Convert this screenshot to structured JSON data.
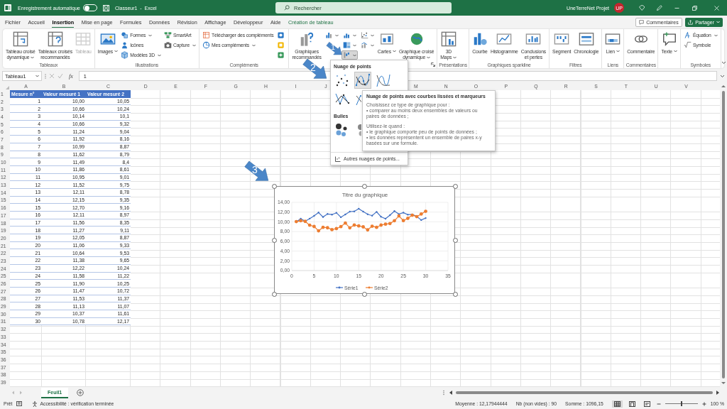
{
  "title_bar": {
    "autosave": {
      "label": "Enregistrement automatique",
      "on": false
    },
    "title": "Classeur1  -  Excel",
    "search": {
      "placeholder": "Rechercher"
    },
    "user": "UneTerreNet Projet",
    "avatar": "UP"
  },
  "menu": {
    "tabs": [
      {
        "label": "Fichier",
        "selected": false,
        "kind": "normal"
      },
      {
        "label": "Accueil",
        "selected": false,
        "kind": "normal"
      },
      {
        "label": "Insertion",
        "selected": true,
        "kind": "normal"
      },
      {
        "label": "Mise en page",
        "selected": false,
        "kind": "normal"
      },
      {
        "label": "Formules",
        "selected": false,
        "kind": "normal"
      },
      {
        "label": "Données",
        "selected": false,
        "kind": "normal"
      },
      {
        "label": "Révision",
        "selected": false,
        "kind": "normal"
      },
      {
        "label": "Affichage",
        "selected": false,
        "kind": "normal"
      },
      {
        "label": "Développeur",
        "selected": false,
        "kind": "normal"
      },
      {
        "label": "Aide",
        "selected": false,
        "kind": "normal"
      },
      {
        "label": "Création de tableau",
        "selected": false,
        "kind": "contextual"
      }
    ],
    "buttons": [
      {
        "label": "Commentaires",
        "kind": "outline"
      },
      {
        "label": "Partager",
        "kind": "primary"
      }
    ]
  },
  "ribbon": {
    "groups": [
      {
        "label": "Tableaux",
        "launcher": false,
        "items": [
          {
            "kind": "large",
            "lines": [
              "Tableau croisé",
              "dynamique"
            ],
            "dropdown": true,
            "disabled": false
          },
          {
            "kind": "large",
            "lines": [
              "Tableaux croisés",
              "recommandés"
            ],
            "dropdown": false,
            "disabled": false
          },
          {
            "kind": "large",
            "lines": [
              "Tableau"
            ],
            "dropdown": false,
            "disabled": true
          }
        ]
      },
      {
        "label": "Illustrations",
        "launcher": false,
        "items": [
          {
            "kind": "large",
            "lines": [
              "Images"
            ],
            "dropdown": true,
            "disabled": false
          },
          {
            "kind": "stack",
            "items": [
              {
                "kind": "small",
                "label": "Formes",
                "dropdown": true
              },
              {
                "kind": "small",
                "label": "Icônes",
                "dropdown": false
              },
              {
                "kind": "small",
                "label": "Modèles 3D",
                "dropdown": true
              }
            ]
          },
          {
            "kind": "stack",
            "items": [
              {
                "kind": "small",
                "label": "SmartArt",
                "dropdown": false
              },
              {
                "kind": "small",
                "label": "Capture",
                "dropdown": true
              }
            ]
          }
        ]
      },
      {
        "label": "Compléments",
        "launcher": false,
        "items": [
          {
            "kind": "stack",
            "items": [
              {
                "kind": "small",
                "label": "Télécharger des compléments",
                "dropdown": false
              },
              {
                "kind": "small",
                "label": "Mes compléments",
                "dropdown": true
              }
            ]
          },
          {
            "kind": "stack",
            "items": [
              {
                "kind": "icon",
                "dropdown": false,
                "expanded": false
              },
              {
                "kind": "icon",
                "dropdown": false,
                "expanded": false
              },
              {
                "kind": "icon",
                "dropdown": false,
                "expanded": false
              }
            ]
          }
        ]
      },
      {
        "launcher": true,
        "items": [
          {
            "kind": "large",
            "lines": [
              "Graphiques",
              "recommandés"
            ],
            "dropdown": false,
            "disabled": false
          },
          {
            "kind": "stack",
            "items": [
              {
                "kind": "icon",
                "dropdown": true,
                "expanded": false
              }
            ]
          },
          {
            "kind": "stack",
            "items": [
              {
                "kind": "icon",
                "dropdown": true,
                "expanded": false
              },
              {
                "kind": "icon",
                "dropdown": true,
                "expanded": false
              },
              {
                "kind": "icon",
                "dropdown": true,
                "expanded": true
              }
            ]
          },
          {
            "kind": "stack",
            "items": [
              {
                "kind": "icon",
                "dropdown": true,
                "expanded": false
              },
              {
                "kind": "icon",
                "dropdown": true,
                "expanded": false
              }
            ]
          },
          {
            "kind": "large",
            "lines": [
              "Cartes"
            ],
            "dropdown": true,
            "disabled": false
          },
          {
            "kind": "large",
            "lines": [
              "Graphique croisé",
              "dynamique"
            ],
            "dropdown": true,
            "disabled": false
          }
        ]
      },
      {
        "label": "Présentations",
        "launcher": false,
        "items": [
          {
            "kind": "large",
            "lines": [
              "3D",
              "Maps"
            ],
            "dropdown": true,
            "disabled": false
          }
        ]
      },
      {
        "label": "Graphiques sparkline",
        "launcher": false,
        "items": [
          {
            "kind": "large",
            "lines": [
              "Courbe"
            ],
            "dropdown": false,
            "disabled": false
          },
          {
            "kind": "large",
            "lines": [
              "Histogramme"
            ],
            "dropdown": false,
            "disabled": false
          },
          {
            "kind": "large",
            "lines": [
              "Conclusions",
              "et pertes"
            ],
            "dropdown": false,
            "disabled": false
          }
        ]
      },
      {
        "label": "Filtres",
        "launcher": false,
        "items": [
          {
            "kind": "large",
            "lines": [
              "Segment"
            ],
            "dropdown": false,
            "disabled": false
          },
          {
            "kind": "large",
            "lines": [
              "Chronologie"
            ],
            "dropdown": false,
            "disabled": false
          }
        ]
      },
      {
        "label": "Liens",
        "launcher": false,
        "items": [
          {
            "kind": "large",
            "lines": [
              "Lien"
            ],
            "dropdown": true,
            "disabled": false
          }
        ]
      },
      {
        "label": "Commentaires",
        "launcher": false,
        "items": [
          {
            "kind": "large",
            "lines": [
              "Commentaire"
            ],
            "dropdown": false,
            "disabled": false
          }
        ]
      },
      {
        "launcher": false,
        "items": [
          {
            "kind": "large",
            "lines": [
              "Texte"
            ],
            "dropdown": true,
            "disabled": false
          }
        ]
      },
      {
        "label": "Symboles",
        "launcher": false,
        "items": [
          {
            "kind": "stack",
            "items": [
              {
                "kind": "small",
                "label": "Équation",
                "dropdown": true
              },
              {
                "kind": "small",
                "label": "Symbole",
                "dropdown": false
              }
            ]
          }
        ]
      }
    ]
  },
  "formula_bar": {
    "name_box": "Tableau1",
    "function_label": "fx",
    "formula": "1"
  },
  "sheet": {
    "columns": [
      {
        "label": "A"
      },
      {
        "label": "B"
      },
      {
        "label": "C"
      },
      {
        "label": "D"
      },
      {
        "label": "E"
      },
      {
        "label": "F"
      },
      {
        "label": "G"
      },
      {
        "label": "H"
      },
      {
        "label": "I"
      },
      {
        "label": "J"
      },
      {},
      {},
      {
        "label": "M"
      },
      {
        "label": "N"
      },
      {
        "label": "O"
      },
      {
        "label": "P"
      },
      {
        "label": "Q"
      },
      {
        "label": "R"
      },
      {
        "label": "S"
      },
      {
        "label": "T"
      },
      {
        "label": "U"
      },
      {
        "label": "V"
      }
    ],
    "rows": [
      "1",
      "2",
      "3",
      "4",
      "5",
      "6",
      "7",
      "8",
      "9",
      "10",
      "11",
      "12",
      "13",
      "14",
      "15",
      "16",
      "17",
      "18",
      "19",
      "20",
      "21",
      "22",
      "23",
      "24",
      "25",
      "26",
      "27",
      "28",
      "29",
      "30",
      "31",
      "32",
      "33",
      "34",
      "35",
      "36",
      "37",
      "38",
      "39"
    ],
    "table": {
      "headers": [
        "Mesure n°",
        "Valeur mesuré 1",
        "Valeur mesuré 2"
      ],
      "rows": [
        [
          "1",
          "10,00",
          "10,05"
        ],
        [
          "2",
          "10,66",
          "10,24"
        ],
        [
          "3",
          "10,14",
          "10,1"
        ],
        [
          "4",
          "10,66",
          "9,32"
        ],
        [
          "5",
          "11,24",
          "9,04"
        ],
        [
          "6",
          "11,92",
          "8,16"
        ],
        [
          "7",
          "10,99",
          "8,87"
        ],
        [
          "8",
          "11,62",
          "8,79"
        ],
        [
          "9",
          "11,49",
          "8,4"
        ],
        [
          "10",
          "11,86",
          "8,61"
        ],
        [
          "11",
          "10,95",
          "9,01"
        ],
        [
          "12",
          "11,52",
          "9,75"
        ],
        [
          "13",
          "12,11",
          "8,78"
        ],
        [
          "14",
          "12,15",
          "9,35"
        ],
        [
          "15",
          "12,70",
          "9,16"
        ],
        [
          "16",
          "12,11",
          "8,97"
        ],
        [
          "17",
          "11,56",
          "8,35"
        ],
        [
          "18",
          "11,27",
          "9,11"
        ],
        [
          "19",
          "12,05",
          "8,87"
        ],
        [
          "20",
          "11,06",
          "9,33"
        ],
        [
          "21",
          "10,64",
          "9,53"
        ],
        [
          "22",
          "11,38",
          "9,65"
        ],
        [
          "23",
          "12,22",
          "10,24"
        ],
        [
          "24",
          "11,58",
          "11,22"
        ],
        [
          "25",
          "11,90",
          "10,25"
        ],
        [
          "26",
          "11,47",
          "10,72"
        ],
        [
          "27",
          "11,53",
          "11,37"
        ],
        [
          "28",
          "11,13",
          "11,07"
        ],
        [
          "29",
          "10,37",
          "11,61"
        ],
        [
          "30",
          "10,78",
          "12,17"
        ]
      ]
    }
  },
  "chart": {
    "chart_data": {
      "type": "line",
      "title": "Titre du graphique",
      "x": [
        1,
        2,
        3,
        4,
        5,
        6,
        7,
        8,
        9,
        10,
        11,
        12,
        13,
        14,
        15,
        16,
        17,
        18,
        19,
        20,
        21,
        22,
        23,
        24,
        25,
        26,
        27,
        28,
        29,
        30
      ],
      "series": [
        {
          "name": "Série1",
          "color": "#4472c4",
          "values": [
            10.0,
            10.66,
            10.14,
            10.66,
            11.24,
            11.92,
            10.99,
            11.62,
            11.49,
            11.86,
            10.95,
            11.52,
            12.11,
            12.15,
            12.7,
            12.11,
            11.56,
            11.27,
            12.05,
            11.06,
            10.64,
            11.38,
            12.22,
            11.58,
            11.9,
            11.47,
            11.53,
            11.13,
            10.37,
            10.78
          ]
        },
        {
          "name": "Série2",
          "color": "#ed7d31",
          "values": [
            10.05,
            10.24,
            10.1,
            9.32,
            9.04,
            8.16,
            8.87,
            8.79,
            8.4,
            8.61,
            9.01,
            9.75,
            8.78,
            9.35,
            9.16,
            8.97,
            8.35,
            9.11,
            8.87,
            9.33,
            9.53,
            9.65,
            10.24,
            11.22,
            10.25,
            10.72,
            11.37,
            11.07,
            11.61,
            12.17
          ]
        }
      ],
      "grid": true,
      "legend": true,
      "xlim": [
        0,
        35
      ],
      "ylim": [
        0,
        14
      ],
      "xticks": [
        {
          "value": 0,
          "label": "0"
        },
        {
          "value": 5,
          "label": "5"
        },
        {
          "value": 10,
          "label": "10"
        },
        {
          "value": 15,
          "label": "15"
        },
        {
          "value": 20,
          "label": "20"
        },
        {
          "value": 25,
          "label": "25"
        },
        {
          "value": 30,
          "label": "30"
        },
        {
          "value": 35,
          "label": "35"
        }
      ],
      "yticks": [
        {
          "value": 0,
          "label": "0,00"
        },
        {
          "value": 2,
          "label": "2,00"
        },
        {
          "value": 4,
          "label": "4,00"
        },
        {
          "value": 6,
          "label": "6,00"
        },
        {
          "value": 8,
          "label": "8,00"
        },
        {
          "value": 10,
          "label": "10,00"
        },
        {
          "value": 12,
          "label": "12,00"
        },
        {
          "value": 14,
          "label": "14,00"
        }
      ]
    }
  },
  "chart_menu": {
    "sections": [
      {
        "heading": "Nuage de points",
        "options": [
          {
            "selected": false
          },
          {
            "selected": true
          },
          {
            "selected": false
          },
          {
            "selected": false
          },
          {
            "selected": false
          }
        ]
      },
      {
        "heading": "Bulles",
        "options": [
          {
            "selected": false
          },
          {
            "selected": false
          }
        ]
      }
    ],
    "footer": "Autres nuages de points...",
    "tooltip": {
      "title": "Nuage de points avec courbes lissées et marqueurs",
      "paragraphs": [
        [
          "Choisissez ce type de graphique pour :",
          "• comparer au moins deux ensembles de valeurs ou paires de données ;"
        ],
        [
          "Utilisez-le quand :",
          "• le graphique comporte peu de points de données ;",
          "• les données représentent un ensemble de paires x-y basées sur une formule."
        ]
      ]
    }
  },
  "callouts": [
    {
      "label": "1"
    },
    {
      "label": "2"
    },
    {
      "label": "3"
    }
  ],
  "sheet_tabs": [
    {
      "label": "Feuil1",
      "selected": true
    }
  ],
  "status_bar": {
    "mode": "Prêt",
    "accessibility": "Accessibilité : vérification terminée",
    "stats": [
      "Moyenne : 12,17944444",
      "Nb (non vides) : 90",
      "Somme : 1096,15"
    ],
    "views": [
      {
        "selected": true
      },
      {
        "selected": false
      },
      {
        "selected": false
      }
    ],
    "zoom": {
      "level": 0.5,
      "reading": "100 %"
    }
  }
}
